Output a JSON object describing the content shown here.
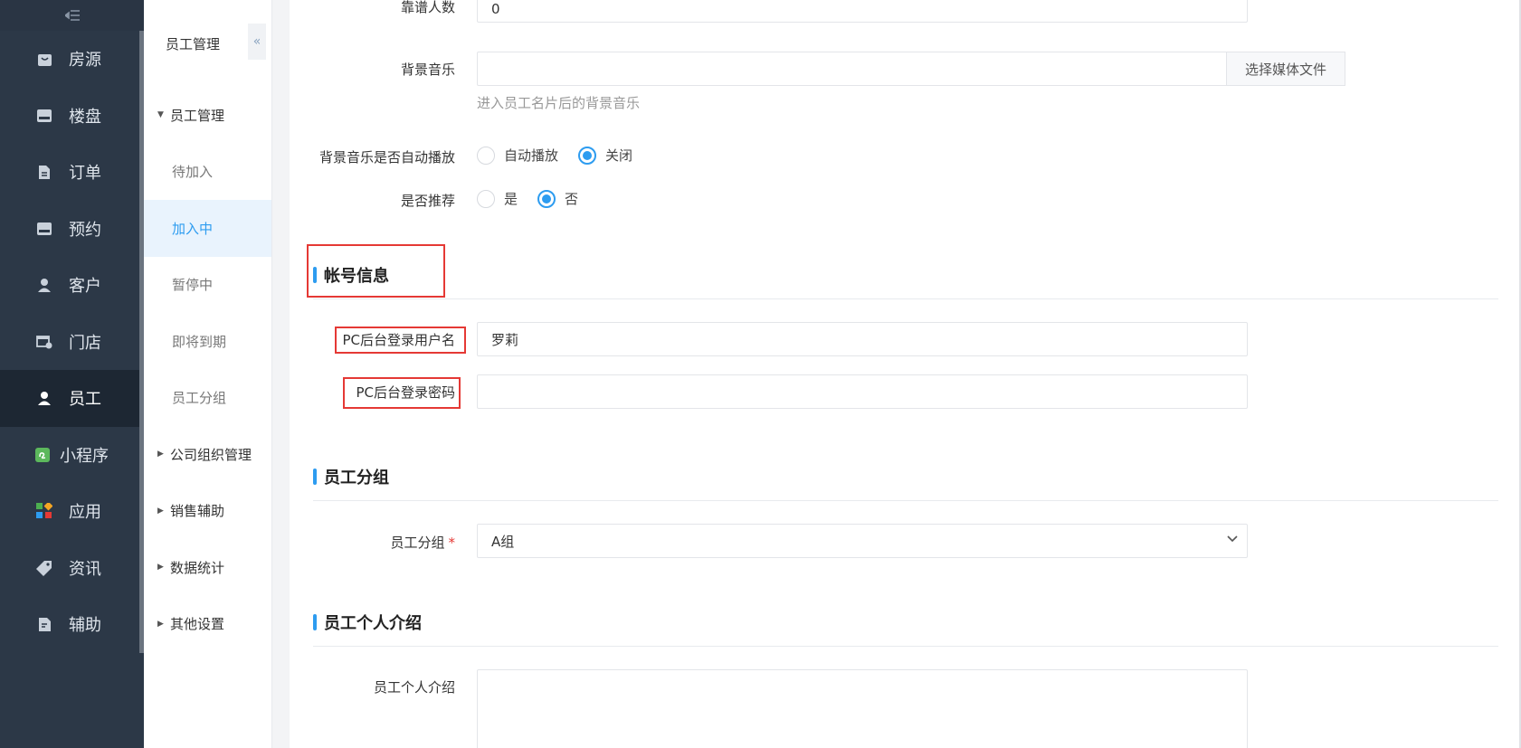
{
  "nav": {
    "toggle_icon": "menu-collapse-icon",
    "items": [
      {
        "label": "房源",
        "icon": "bag-icon"
      },
      {
        "label": "楼盘",
        "icon": "building-icon"
      },
      {
        "label": "订单",
        "icon": "document-icon"
      },
      {
        "label": "预约",
        "icon": "calendar-icon"
      },
      {
        "label": "客户",
        "icon": "user-icon"
      },
      {
        "label": "门店",
        "icon": "store-icon"
      },
      {
        "label": "员工",
        "icon": "staff-icon"
      },
      {
        "label": "小程序",
        "icon": "miniprogram-icon"
      },
      {
        "label": "应用",
        "icon": "apps-icon"
      },
      {
        "label": "资讯",
        "icon": "tag-icon"
      },
      {
        "label": "辅助",
        "icon": "tool-icon"
      }
    ],
    "active_index": 6
  },
  "subnav": {
    "title": "员工管理",
    "collapse_icon": "double-chevron-left-icon",
    "group_expanded": "员工管理",
    "items": [
      "待加入",
      "加入中",
      "暂停中",
      "即将到期",
      "员工分组"
    ],
    "active_item": "加入中",
    "groups": [
      "公司组织管理",
      "销售辅助",
      "数据统计",
      "其他设置"
    ]
  },
  "form": {
    "reliable_count": {
      "label": "靠谱人数",
      "value": "0"
    },
    "bg_music": {
      "label": "背景音乐",
      "button": "选择媒体文件",
      "hint": "进入员工名片后的背景音乐"
    },
    "autoplay": {
      "label": "背景音乐是否自动播放",
      "options": [
        "自动播放",
        "关闭"
      ],
      "selected": "关闭"
    },
    "recommend": {
      "label": "是否推荐",
      "options": [
        "是",
        "否"
      ],
      "selected": "否"
    },
    "account_section": "帐号信息",
    "username": {
      "label": "PC后台登录用户名",
      "value": "罗莉"
    },
    "password": {
      "label": "PC后台登录密码",
      "value": ""
    },
    "group_section": "员工分组",
    "group": {
      "label": "员工分组",
      "required_mark": "*",
      "value": "A组"
    },
    "intro_section": "员工个人介绍",
    "intro": {
      "label": "员工个人介绍",
      "value": ""
    }
  },
  "colors": {
    "accent": "#2d9cf0",
    "nav_bg": "#2c3847",
    "highlight": "#e53935"
  }
}
